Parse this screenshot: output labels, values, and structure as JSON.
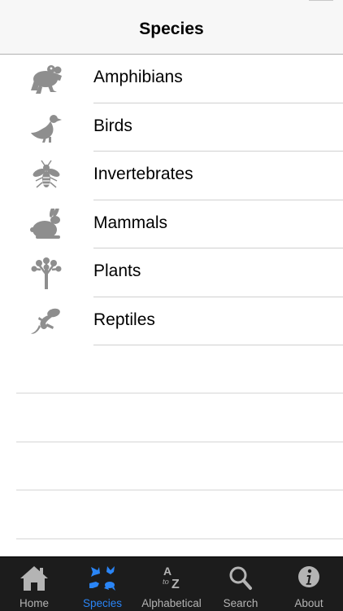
{
  "nav": {
    "title": "Species"
  },
  "species": [
    {
      "label": "Amphibians",
      "icon": "frog-icon"
    },
    {
      "label": "Birds",
      "icon": "bird-icon"
    },
    {
      "label": "Invertebrates",
      "icon": "bee-icon"
    },
    {
      "label": "Mammals",
      "icon": "rabbit-icon"
    },
    {
      "label": "Plants",
      "icon": "tree-icon"
    },
    {
      "label": "Reptiles",
      "icon": "lizard-icon"
    }
  ],
  "tabs": [
    {
      "label": "Home",
      "icon": "house-icon",
      "active": false
    },
    {
      "label": "Species",
      "icon": "species-icon",
      "active": true
    },
    {
      "label": "Alphabetical",
      "icon": "a-to-z-icon",
      "active": false
    },
    {
      "label": "Search",
      "icon": "magnifier-icon",
      "active": false
    },
    {
      "label": "About",
      "icon": "info-icon",
      "active": false
    }
  ],
  "colors": {
    "icon_gray": "#8e8e8e",
    "tab_active": "#2a85f6",
    "tab_inactive": "#b4b4b4",
    "tab_bar_bg": "#1c1c1c"
  }
}
